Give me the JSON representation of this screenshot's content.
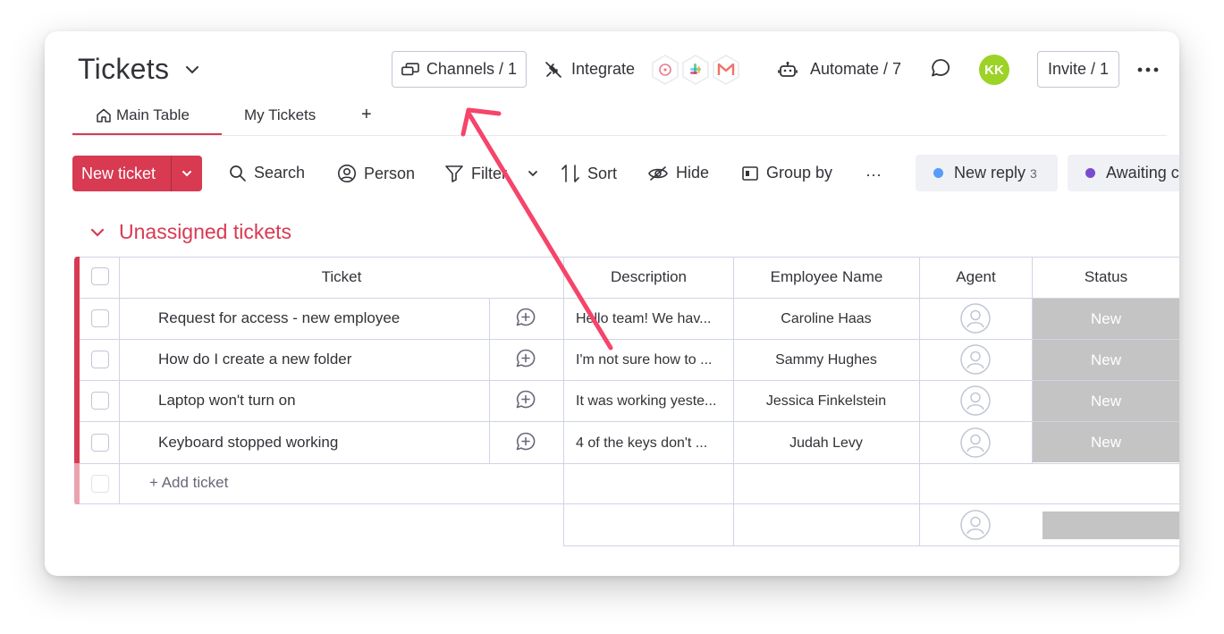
{
  "header": {
    "title": "Tickets",
    "channels_label": "Channels / 1",
    "integrate_label": "Integrate",
    "automate_label": "Automate / 7",
    "avatar_initials": "KK",
    "invite_label": "Invite / 1"
  },
  "tabs": {
    "main": "Main Table",
    "my": "My Tickets",
    "add": "+"
  },
  "toolbar": {
    "new_ticket": "New ticket",
    "search": "Search",
    "person": "Person",
    "filter": "Filter",
    "sort": "Sort",
    "hide": "Hide",
    "group_by": "Group by",
    "more": "···"
  },
  "status_chips": [
    {
      "label": "New reply",
      "count": "3",
      "color": "#579bfc"
    },
    {
      "label": "Awaiting c",
      "color": "#784bd1"
    }
  ],
  "group": {
    "title": "Unassigned tickets",
    "color": "#d83a52"
  },
  "columns": {
    "ticket": "Ticket",
    "description": "Description",
    "employee": "Employee Name",
    "agent": "Agent",
    "status": "Status"
  },
  "rows": [
    {
      "ticket": "Request for access - new employee",
      "description": "Hello team! We hav...",
      "employee": "Caroline Haas",
      "status": "New"
    },
    {
      "ticket": "How do I create a new folder",
      "description": "I'm not sure how to ...",
      "employee": "Sammy Hughes",
      "status": "New"
    },
    {
      "ticket": "Laptop won't turn on",
      "description": "It was working yeste...",
      "employee": "Jessica Finkelstein",
      "status": "New"
    },
    {
      "ticket": "Keyboard stopped working",
      "description": "4 of the keys don't ...",
      "employee": "Judah Levy",
      "status": "New"
    }
  ],
  "add_ticket": "+ Add ticket",
  "colors": {
    "accent": "#d83a52",
    "status_new": "#c4c4c4",
    "avatar_kk": "#9cd326",
    "annotation_arrow": "#f6446a"
  }
}
